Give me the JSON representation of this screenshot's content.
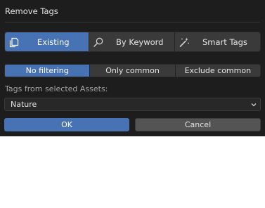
{
  "dialog": {
    "title": "Remove Tags"
  },
  "modes": [
    {
      "label": "Existing",
      "icon": "duplicate-icon",
      "active": true
    },
    {
      "label": "By Keyword",
      "icon": "search-icon",
      "active": false
    },
    {
      "label": "Smart Tags",
      "icon": "magic-wand-icon",
      "active": false
    }
  ],
  "filters": [
    {
      "label": "No filtering",
      "active": true
    },
    {
      "label": "Only common",
      "active": false
    },
    {
      "label": "Exclude common",
      "active": false
    }
  ],
  "tags_field": {
    "label": "Tags from selected Assets:",
    "value": "Nature"
  },
  "buttons": {
    "ok": "OK",
    "cancel": "Cancel"
  },
  "colors": {
    "accent": "#4772b3",
    "background": "#1d1d1d",
    "button": "#3a3a3a"
  }
}
